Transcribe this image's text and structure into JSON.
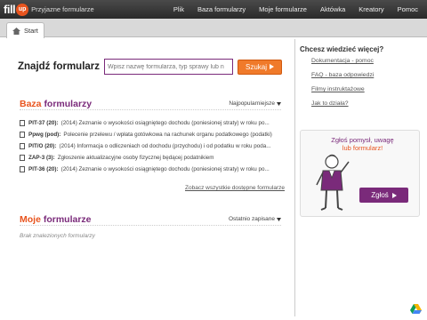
{
  "app": {
    "logo_text": "fill",
    "logo_badge": "up",
    "logo_subtitle": "Przyjazne formularze"
  },
  "nav": [
    "Plik",
    "Baza formularzy",
    "Moje formularze",
    "Aktówka",
    "Kreatory",
    "Pomoc"
  ],
  "tab": {
    "label": "Start"
  },
  "search": {
    "title_prefix": "Znajdź",
    "title_suffix": "formularz",
    "placeholder": "Wpisz nazwę formularza, typ sprawy lub n",
    "button": "Szukaj"
  },
  "baza": {
    "title_a": "Baza",
    "title_b": "formularzy",
    "sort": "Najpopularniejsze",
    "items": [
      {
        "code": "PIT-37 (20):",
        "desc": "(2014) Zeznanie o wysokości osiągniętego dochodu (poniesionej straty) w roku po..."
      },
      {
        "code": "Ppwg (pod):",
        "desc": "Polecenie przelewu / wpłata gotówkowa na rachunek organu podatkowego (podatki)"
      },
      {
        "code": "PIT/O (20):",
        "desc": "(2014) Informacja o odliczeniach od dochodu (przychodu) i od podatku w roku poda..."
      },
      {
        "code": "ZAP-3 (3):",
        "desc": "Zgłoszenie aktualizacyjne osoby fizycznej będącej podatnikiem"
      },
      {
        "code": "PIT-36 (20):",
        "desc": "(2014) Zeznanie o wysokości osiągniętego dochodu (poniesionej straty) w roku po..."
      }
    ],
    "see_all": "Zobacz wszystkie dostępne formularze"
  },
  "moje": {
    "title_a": "Moje",
    "title_b": "formularze",
    "sort": "Ostatnio zapisane",
    "empty": "Brak znalezionych formularzy"
  },
  "side": {
    "title": "Chcesz wiedzieć więcej?",
    "links": [
      "Dokumentacja - pomoc",
      "FAQ - baza odpowiedzi",
      "Filmy instruktażowe",
      "Jak to działa?"
    ]
  },
  "promo": {
    "line1_a": "Zgłoś pomysł, uwagę",
    "line2_b": "lub formularz!",
    "button": "Zgłoś"
  }
}
